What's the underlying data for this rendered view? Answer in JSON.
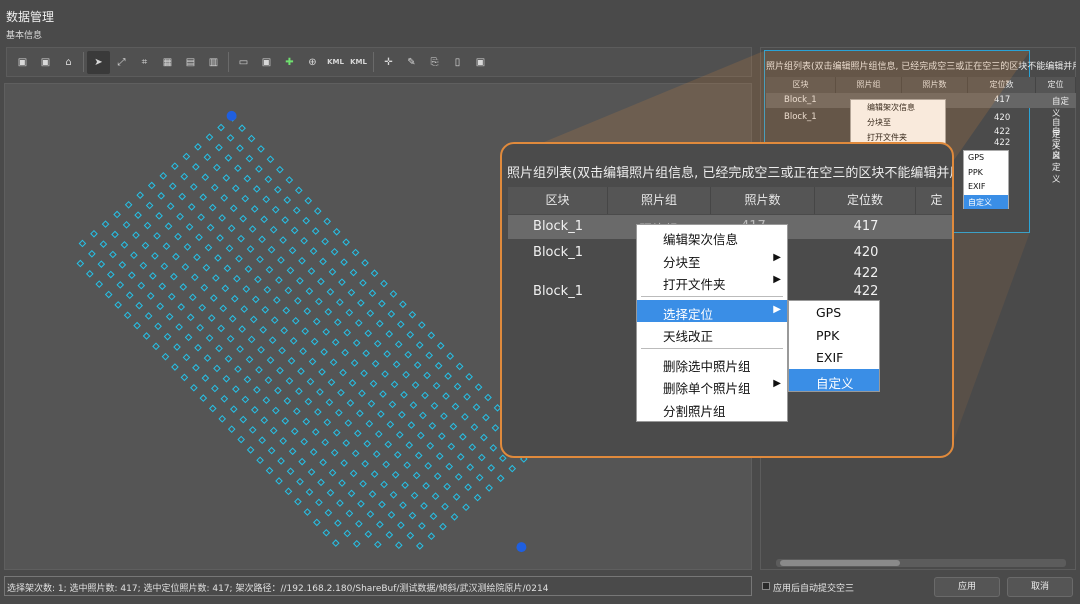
{
  "window": {
    "title": "数据管理",
    "subtitle": "基本信息"
  },
  "toolbar": {
    "buttons": [
      "image-icon",
      "image2-icon",
      "home-icon",
      "pointer-icon",
      "transform-icon",
      "crop-icon",
      "grid-icon",
      "image3-icon",
      "image4-icon",
      "folder-open-icon",
      "photo-icon",
      "add-point-icon",
      "target-icon",
      "kml-icon",
      "kml2-icon",
      "crosshair-icon",
      "eraser-icon",
      "raw-icon",
      "doc-icon",
      "save-icon"
    ],
    "kml_label": "KML"
  },
  "statusbar": {
    "text": "选择架次数: 1; 选中照片数: 417; 选中定位照片数: 417; 架次路径：//192.168.2.180/ShareBuf/测试数据/倾斜/武汉测绘院原片/0214"
  },
  "right_panel": {
    "caption": "照片组列表(双击编辑照片组信息, 已经完成空三或正在空三的区块不能编辑并用灰色背景",
    "columns": [
      "区块",
      "照片组",
      "照片数",
      "定位数",
      "定位"
    ],
    "rows": [
      {
        "block": "Block_1",
        "loc_count": "417",
        "loc": "自定义"
      },
      {
        "block": "Block_1",
        "loc_count": "420",
        "loc": "自定义"
      },
      {
        "block": "",
        "loc_count": "422",
        "loc": "自定义"
      },
      {
        "block": "",
        "loc_count": "422",
        "loc": "自定义"
      }
    ],
    "context_menu": [
      "编辑架次信息",
      "分块至",
      "打开文件夹"
    ],
    "sub_menu": [
      "GPS",
      "PPK",
      "EXIF",
      "自定义"
    ],
    "auto_submit_label": "应用后自动提交空三",
    "apply_label": "应用",
    "cancel_label": "取消"
  },
  "zoom": {
    "caption": "照片组列表(双击编辑照片组信息, 已经完成空三或正在空三的区块不能编辑并用灰色",
    "columns": [
      "区块",
      "照片组",
      "照片数",
      "定位数",
      "定"
    ],
    "rows": [
      {
        "block": "Block_1",
        "loc_count": "417"
      },
      {
        "block": "Block_1",
        "loc_count": "420"
      },
      {
        "block": "Block_1",
        "loc_count": "422"
      }
    ],
    "extra_count": "422",
    "row1_group_partial": "照片组",
    "row1_count_partial": "417",
    "context_menu": [
      {
        "label": "编辑架次信息",
        "arrow": false
      },
      {
        "label": "分块至",
        "arrow": true
      },
      {
        "label": "打开文件夹",
        "arrow": true
      },
      {
        "label": "选择定位",
        "arrow": true,
        "selected": true
      },
      {
        "label": "天线改正",
        "arrow": false
      },
      {
        "label": "删除选中照片组",
        "arrow": false
      },
      {
        "label": "删除单个照片组",
        "arrow": true
      },
      {
        "label": "分割照片组",
        "arrow": false
      }
    ],
    "sub_menu": [
      {
        "label": "GPS"
      },
      {
        "label": "PPK"
      },
      {
        "label": "EXIF"
      },
      {
        "label": "自定义",
        "selected": true
      }
    ],
    "arrow_glyph": "▶"
  },
  "colors": {
    "accent": "#3a8ee6",
    "highlight_border": "#2aa3d6",
    "zoom_border": "#e08a3c",
    "point": "#25c2e8",
    "point_blue": "#1f5fe0"
  }
}
